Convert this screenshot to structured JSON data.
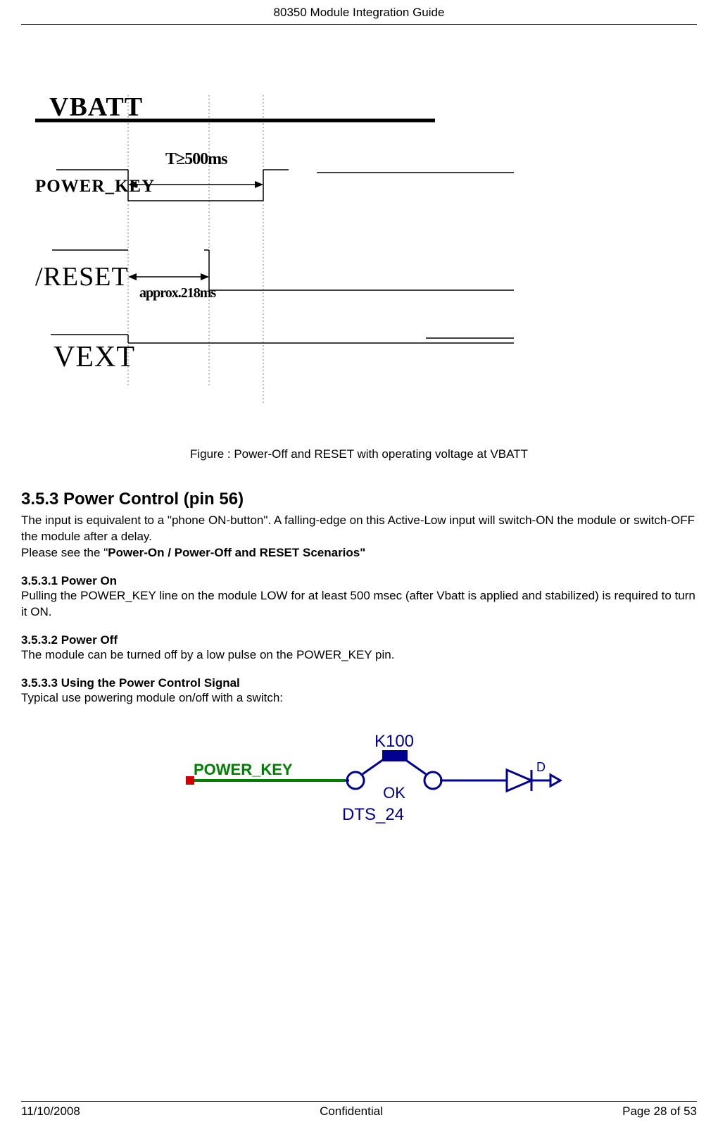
{
  "header": {
    "title": "80350 Module Integration Guide"
  },
  "timing_diagram": {
    "signals": {
      "vbatt": "VBATT",
      "power_key": "POWER_KEY",
      "reset": "/RESET",
      "vext": "VEXT"
    },
    "annotations": {
      "t_500": "T≥500ms",
      "approx_218": "approx.218ms"
    }
  },
  "figure_caption": "Figure : Power-Off and RESET with operating voltage at VBATT",
  "section": {
    "heading": "3.5.3  Power Control (pin 56)",
    "intro1": "The input is equivalent to a \"phone ON-button\". A falling-edge on this Active-Low input will switch-ON the module or switch-OFF the module after a delay.",
    "intro2a": "Please see the \"",
    "intro2b": "Power-On / Power-Off and RESET Scenarios\""
  },
  "sub1": {
    "heading": "3.5.3.1 Power On",
    "text": "Pulling the POWER_KEY line on the module LOW for at least 500 msec (after Vbatt is applied and stabilized) is required to turn it ON."
  },
  "sub2": {
    "heading": "3.5.3.2 Power Off",
    "text": "The module can be turned off by a low pulse on the POWER_KEY pin."
  },
  "sub3": {
    "heading": "3.5.3.3 Using the Power Control Signal",
    "text": "Typical use powering module on/off with a switch:"
  },
  "circuit": {
    "power_key_label": "POWER_KEY",
    "k100_label": "K100",
    "ok_label": "OK",
    "dts24_label": "DTS_24",
    "d_label": "D"
  },
  "footer": {
    "date": "11/10/2008",
    "center": "Confidential",
    "page": "Page 28 of 53"
  }
}
